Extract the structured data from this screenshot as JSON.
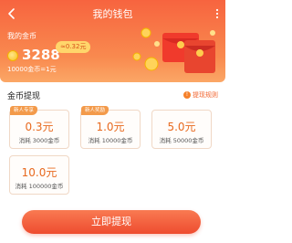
{
  "header": {
    "title": "我的钱包",
    "balance_label": "我的金币",
    "balance_value": "3288",
    "approx_value": "≈0.32元",
    "rate": "10000金币=1元"
  },
  "withdraw": {
    "section_title": "金币提现",
    "rules_link": "提现规则",
    "options": [
      {
        "tag": "新人专享",
        "amount": "0.3元",
        "cost": "消耗 3000金币"
      },
      {
        "tag": "新人奖励",
        "amount": "1.0元",
        "cost": "消耗 10000金币"
      },
      {
        "tag": "",
        "amount": "5.0元",
        "cost": "消耗 50000金币"
      },
      {
        "tag": "",
        "amount": "10.0元",
        "cost": "消耗 100000金币"
      }
    ],
    "button_label": "立即提现"
  },
  "colors": {
    "header": "#f7643f",
    "accent": "#e86a1f",
    "button": "#ee4c2f"
  }
}
